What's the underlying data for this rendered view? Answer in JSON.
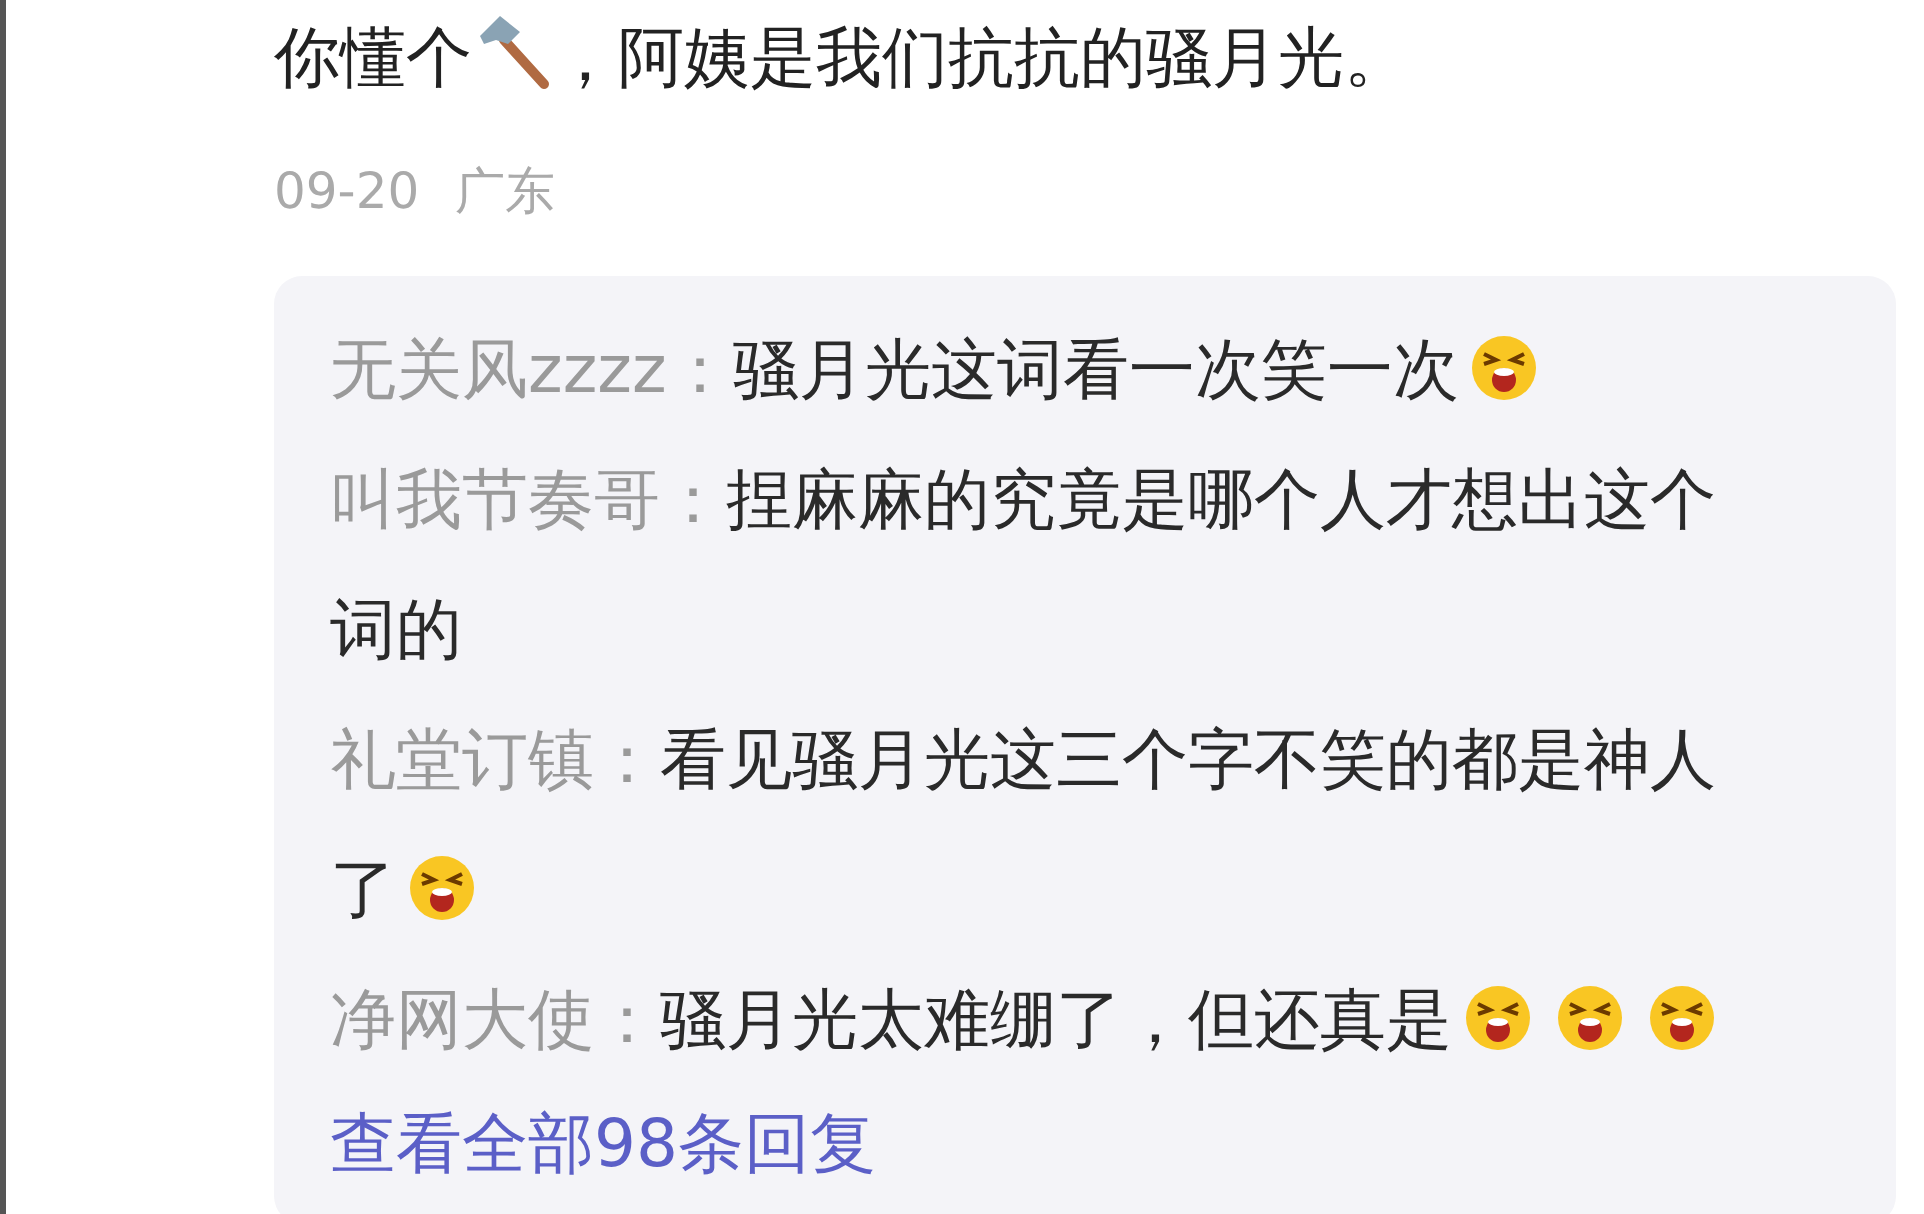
{
  "comment": {
    "content": [
      {
        "kind": "text",
        "text": "你懂个"
      },
      {
        "kind": "hammer"
      },
      {
        "kind": "text",
        "text": "，阿姨是我们抗抗的骚月光。"
      }
    ],
    "date": "09-20",
    "location": "广东"
  },
  "replies": [
    {
      "author": "无关风zzzz：",
      "content": [
        {
          "kind": "text",
          "text": "骚月光这词看一次笑一次"
        },
        {
          "kind": "laugh"
        }
      ]
    },
    {
      "author": "叫我节奏哥：",
      "content": [
        {
          "kind": "text",
          "text": "捏麻麻的究竟是哪个人才想出这个词的"
        }
      ]
    },
    {
      "author": "礼堂订镇：",
      "content": [
        {
          "kind": "text",
          "text": "看见骚月光这三个字不笑的都是神人"
        },
        {
          "kind": "text",
          "text": "了"
        },
        {
          "kind": "laugh"
        }
      ]
    },
    {
      "author": "净网大使：",
      "content": [
        {
          "kind": "text",
          "text": "骚月光太难绷了，但还真是"
        },
        {
          "kind": "laugh"
        },
        {
          "kind": "laugh"
        },
        {
          "kind": "laugh"
        }
      ]
    }
  ],
  "view_all": "查看全部98条回复"
}
